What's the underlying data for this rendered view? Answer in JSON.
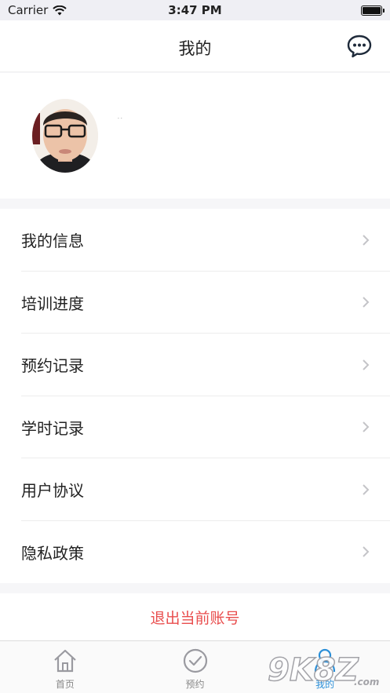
{
  "status_bar": {
    "carrier": "Carrier",
    "time": "3:47 PM"
  },
  "nav": {
    "title": "我的",
    "message_icon": "chat-bubble-icon"
  },
  "profile": {
    "nickname": "· ·"
  },
  "menu": [
    {
      "label": "我的信息"
    },
    {
      "label": "培训进度"
    },
    {
      "label": "预约记录"
    },
    {
      "label": "学时记录"
    },
    {
      "label": "用户协议"
    },
    {
      "label": "隐私政策"
    }
  ],
  "logout": {
    "label": "退出当前账号"
  },
  "tabbar": [
    {
      "label": "首页",
      "icon": "home-icon"
    },
    {
      "label": "预约",
      "icon": "check-circle-icon"
    },
    {
      "label": "我的",
      "icon": "person-icon",
      "active": true
    }
  ],
  "colors": {
    "accent": "#2a8fd8",
    "logout": "#e94d4d",
    "background": "#f6f6f8"
  },
  "watermark": {
    "text": "9K8Z.com"
  }
}
